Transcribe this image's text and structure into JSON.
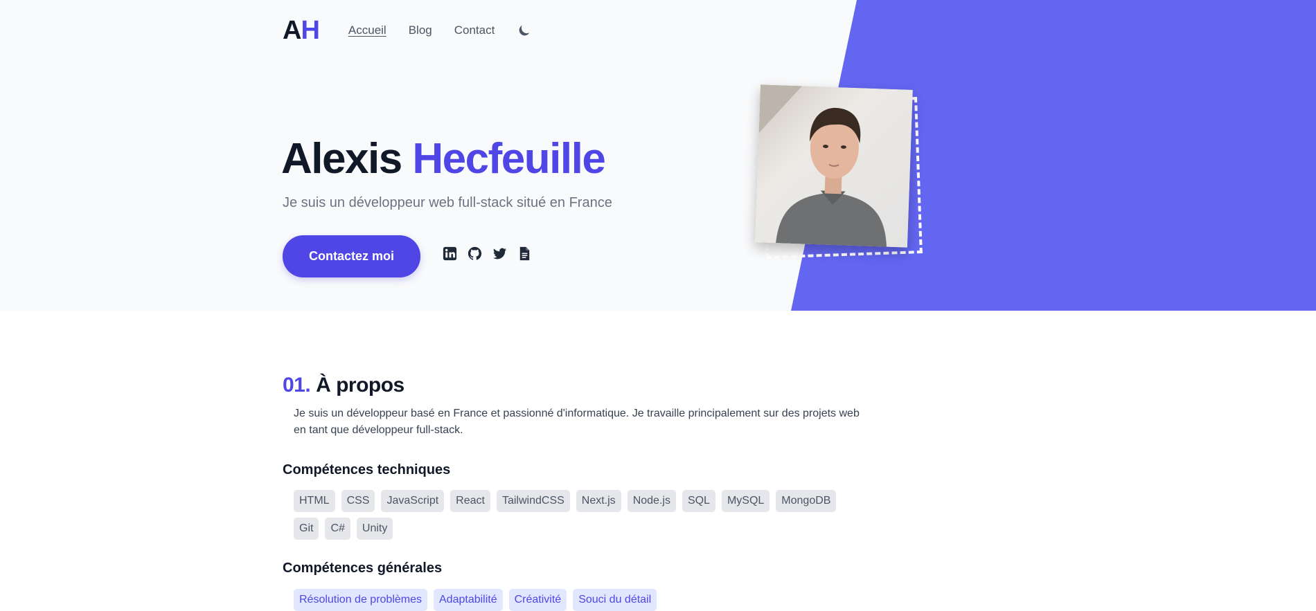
{
  "nav": {
    "logo_a": "A",
    "logo_h": "H",
    "links": [
      "Accueil",
      "Blog",
      "Contact"
    ],
    "active": "Accueil",
    "theme_toggle_icon": "moon-icon"
  },
  "hero": {
    "first_name": "Alexis",
    "last_name": "Hecfeuille",
    "subtitle": "Je suis un développeur web full-stack situé en France",
    "cta_label": "Contactez moi",
    "social_icons": [
      "linkedin-icon",
      "github-icon",
      "twitter-icon",
      "resume-document-icon"
    ]
  },
  "about": {
    "number": "01.",
    "title": "À propos",
    "text": "Je suis un développeur basé en France et passionné d'informatique. Je travaille principalement sur des projets web en tant que développeur full-stack.",
    "tech_title": "Compétences techniques",
    "tech_skills": [
      "HTML",
      "CSS",
      "JavaScript",
      "React",
      "TailwindCSS",
      "Next.js",
      "Node.js",
      "SQL",
      "MySQL",
      "MongoDB",
      "Git",
      "C#",
      "Unity"
    ],
    "general_title": "Compétences générales",
    "general_skills": [
      "Résolution de problèmes",
      "Adaptabilité",
      "Créativité",
      "Souci du détail"
    ]
  },
  "colors": {
    "accent": "#4f46e5",
    "hero_shape": "#6366f1",
    "text_dark": "#111827"
  }
}
